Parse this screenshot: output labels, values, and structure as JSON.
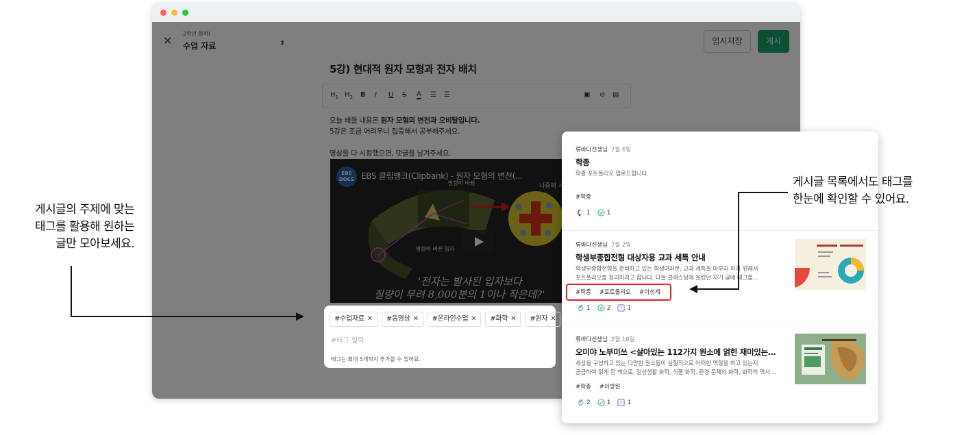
{
  "annotations": {
    "left": [
      "게시글의 주제에 맞는",
      "태그를 활용해 원하는",
      "글만 모아보세요."
    ],
    "right": [
      "게시글 목록에서도 태그를",
      "한눈에 확인할 수 있어요."
    ]
  },
  "editor": {
    "crumb_small": "2학년 화학I",
    "crumb_main": "수업 자료",
    "save_label": "임시저장",
    "post_label": "게시",
    "title": "5강) 현대적 원자 모형과 전자 배치",
    "toolbar": [
      "H1",
      "H2",
      "B",
      "I",
      "U",
      "S",
      "A",
      "ordered-list",
      "bullet-list",
      "image",
      "attach",
      "video"
    ],
    "body_line1_prefix": "오늘 배울 내용은 ",
    "body_line1_bold": "원자 모형의 변천과 오비탈입니다.",
    "body_line2": "5강은 조금 어려우니 집중해서 공부해주세요.",
    "body_line3": "영상을 다 시청했으면, 댓글을 남겨주세요.",
    "video": {
      "channel_badge": "EBS DOCS",
      "title": "EBS 클립뱅크(Clipbank) - 원자 모형의 변천(...",
      "watch_later": "나중에 시",
      "label_a": "방향이 바뀐 입자",
      "label_b": "방향이 바뀜",
      "subtitle1": "'전자는 발사된 입자보다",
      "subtitle2": "질량이 무려 8,000분의 1이나 작은데?'"
    }
  },
  "tag_panel": {
    "chips": [
      "#수업자료",
      "#동영상",
      "#온라인수업",
      "#화학",
      "#원자"
    ],
    "placeholder": "#태그 입력",
    "hint": "태그는 최대 5개까지 추가할 수 있어요."
  },
  "posts": [
    {
      "author": "류바다선생님",
      "date": "7월 6일",
      "title": "학종",
      "excerpt1": "학종 포트폴리오 업로드합니다.",
      "excerpt2": "",
      "tags": [
        "#학종"
      ],
      "stats": [
        {
          "icon": "comment-icon",
          "count": "1"
        },
        {
          "icon": "check-icon",
          "count": "1"
        }
      ]
    },
    {
      "author": "류바다선생님",
      "date": "7월 2일",
      "title": "학생부종합전형 대상자용 교과 세특 안내",
      "excerpt1": "학생부종합전형을 준비하고 있는 학생여러분, 교과 세특을 마무리 하기 위해서",
      "excerpt2": "포트폴리오를 정리하려고 합니다. 다들 클래스팅에 올렸던 자기 글에 태그를…",
      "tags": [
        "#학종",
        "#포트폴리오",
        "#이성계"
      ],
      "stats": [
        {
          "icon": "clap-icon",
          "count": "1"
        },
        {
          "icon": "check-icon",
          "count": "2"
        },
        {
          "icon": "question-icon",
          "count": "1"
        }
      ]
    },
    {
      "author": "류바다선생님",
      "date": "2월 16일",
      "title": "오미야 노부미쓰 <살아있는 112가지 원소에 얽힌 재미있는…",
      "excerpt1": "세상을 구성하고 있는 다양한 원소들이 실질적으로 어떠한 역할을 하고 있는지",
      "excerpt2": "궁금하여 읽게 된 책으로, 일상생활 화학, 식품 화학, 환경 문제와 화학, 화학의 역사…",
      "tags": [
        "#학종",
        "#이방원"
      ],
      "stats": [
        {
          "icon": "clap-icon",
          "count": "2"
        },
        {
          "icon": "check-icon",
          "count": "1"
        },
        {
          "icon": "question-icon",
          "count": "1"
        }
      ]
    }
  ],
  "colors": {
    "accent_green": "#1a9e6b",
    "highlight_red": "#e02424",
    "chart_red": "#e8473c",
    "chart_teal": "#2aa9b8"
  }
}
